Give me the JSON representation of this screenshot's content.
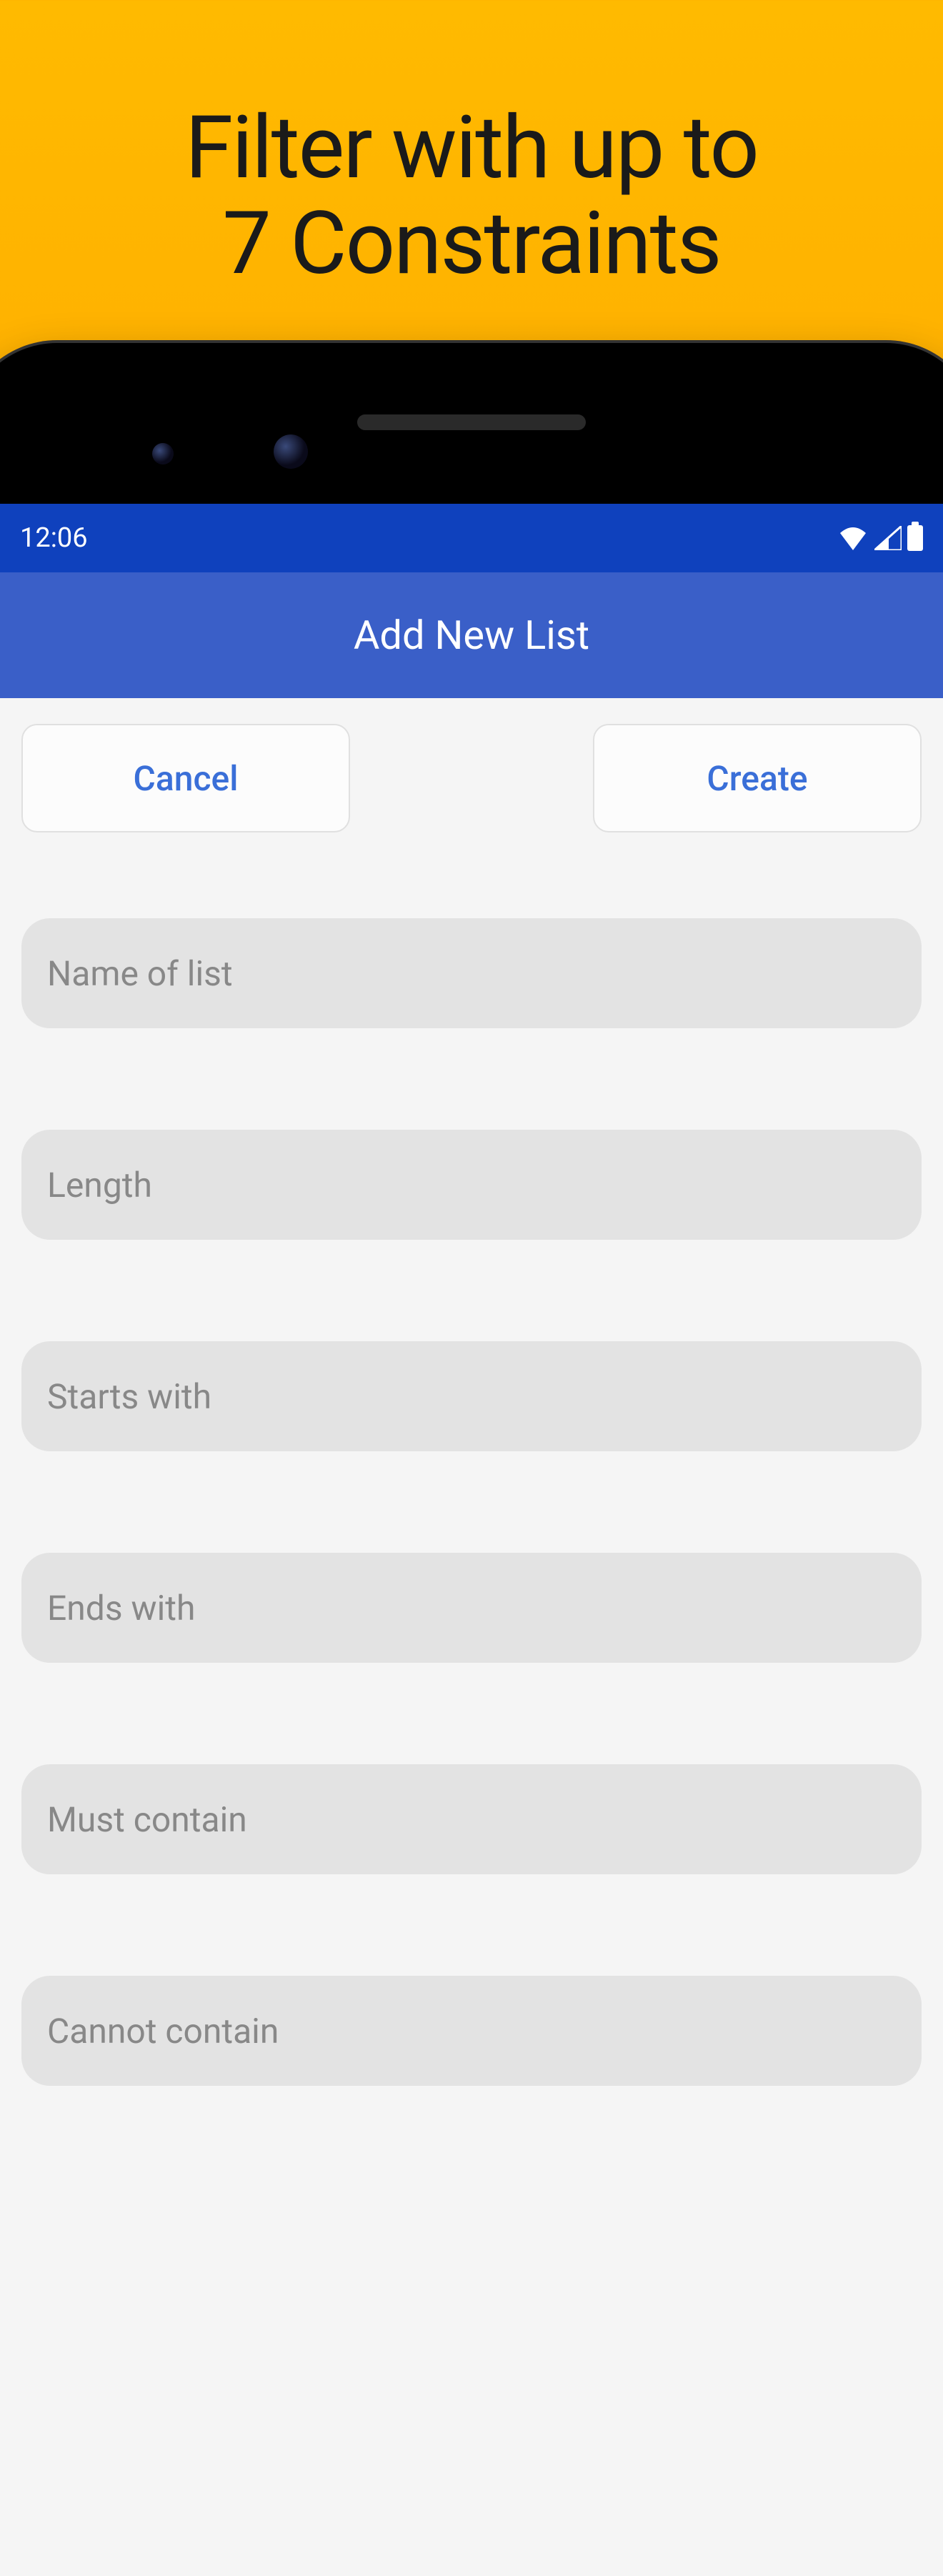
{
  "promo": {
    "line1": "Filter with up to",
    "line2": "7 Constraints"
  },
  "statusBar": {
    "time": "12:06"
  },
  "header": {
    "title": "Add New List"
  },
  "buttons": {
    "cancel": "Cancel",
    "create": "Create"
  },
  "fields": {
    "name": {
      "placeholder": "Name of list",
      "value": ""
    },
    "length": {
      "placeholder": "Length",
      "value": ""
    },
    "startsWith": {
      "placeholder": "Starts with",
      "value": ""
    },
    "endsWith": {
      "placeholder": "Ends with",
      "value": ""
    },
    "mustContain": {
      "placeholder": "Must contain",
      "value": ""
    },
    "cannotContain": {
      "placeholder": "Cannot contain",
      "value": ""
    }
  }
}
